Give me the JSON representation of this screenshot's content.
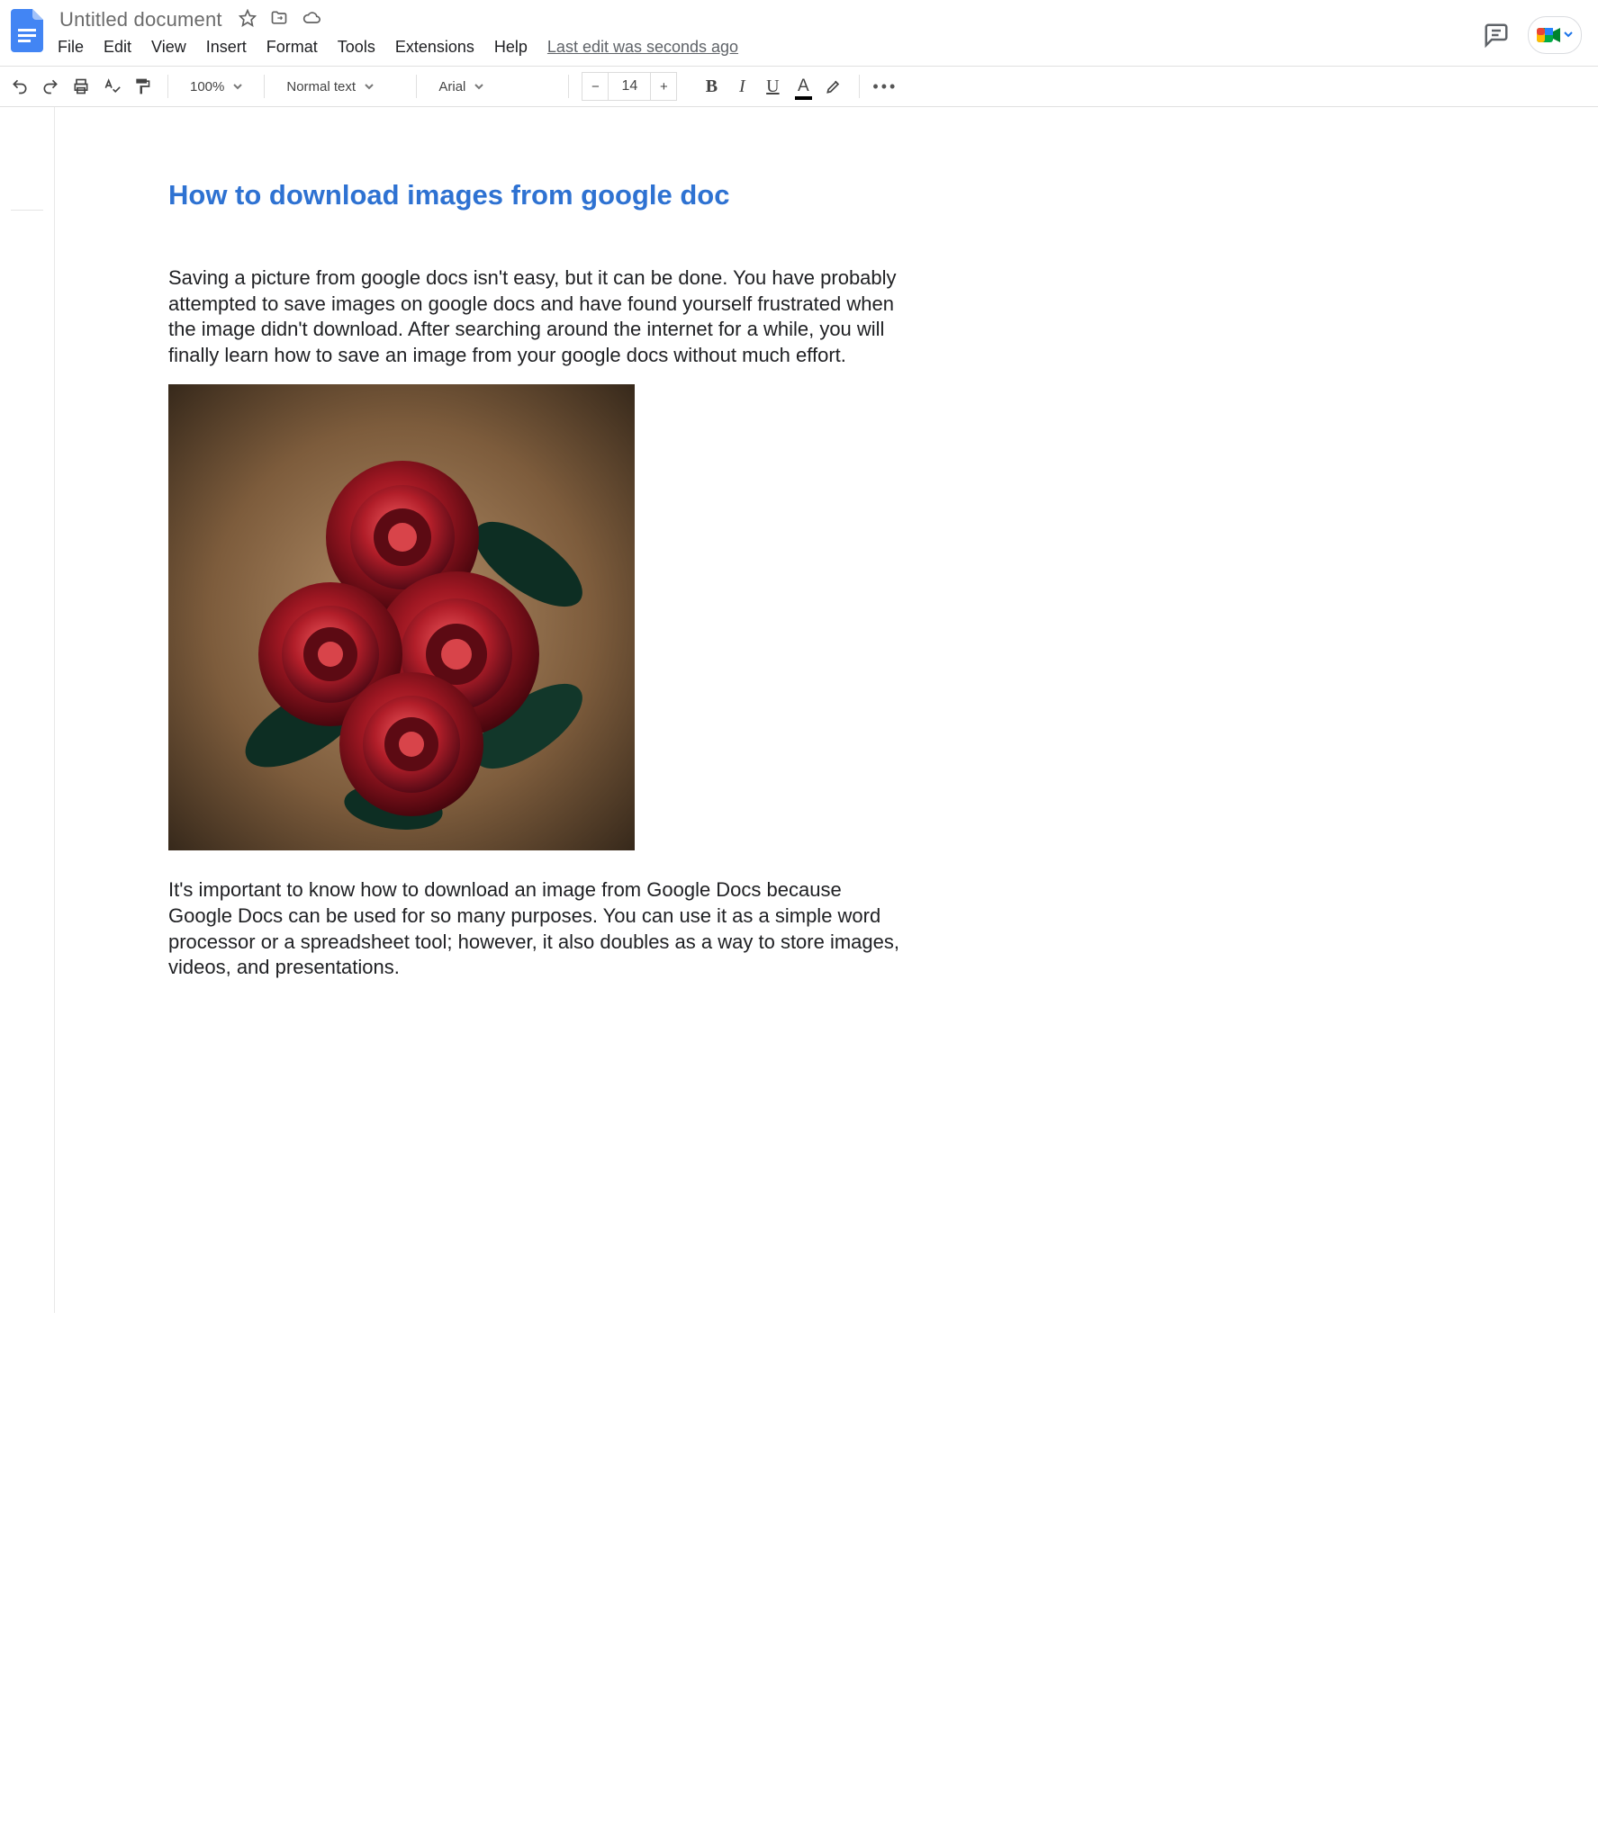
{
  "titlebar": {
    "doc_title": "Untitled document",
    "last_edit": "Last edit was seconds ago"
  },
  "menubar": {
    "items": [
      "File",
      "Edit",
      "View",
      "Insert",
      "Format",
      "Tools",
      "Extensions",
      "Help"
    ]
  },
  "toolbar": {
    "zoom": "100%",
    "style": "Normal text",
    "font": "Arial",
    "font_size": "14",
    "minus": "−",
    "plus": "+",
    "bold": "B",
    "italic": "I",
    "underline": "U",
    "text_color": "A",
    "more": "•••"
  },
  "outline": {
    "items": [
      "",
      ""
    ]
  },
  "document": {
    "heading": "How to download images from google doc",
    "p1": "Saving a picture from google docs isn't easy, but it can be done. You have probably attempted to save images on google docs and have found yourself frustrated when the image didn't download. After searching around the internet for a while, you will finally learn how to save an image from your google docs without much effort.",
    "image_alt": "Photograph of red roses on a wooden background",
    "p2": "It's important to know how to download an image from Google Docs because Google Docs can be used for so many purposes. You can use it as a simple word processor or a spreadsheet tool; however, it also doubles as a way to store images, videos, and presentations."
  }
}
